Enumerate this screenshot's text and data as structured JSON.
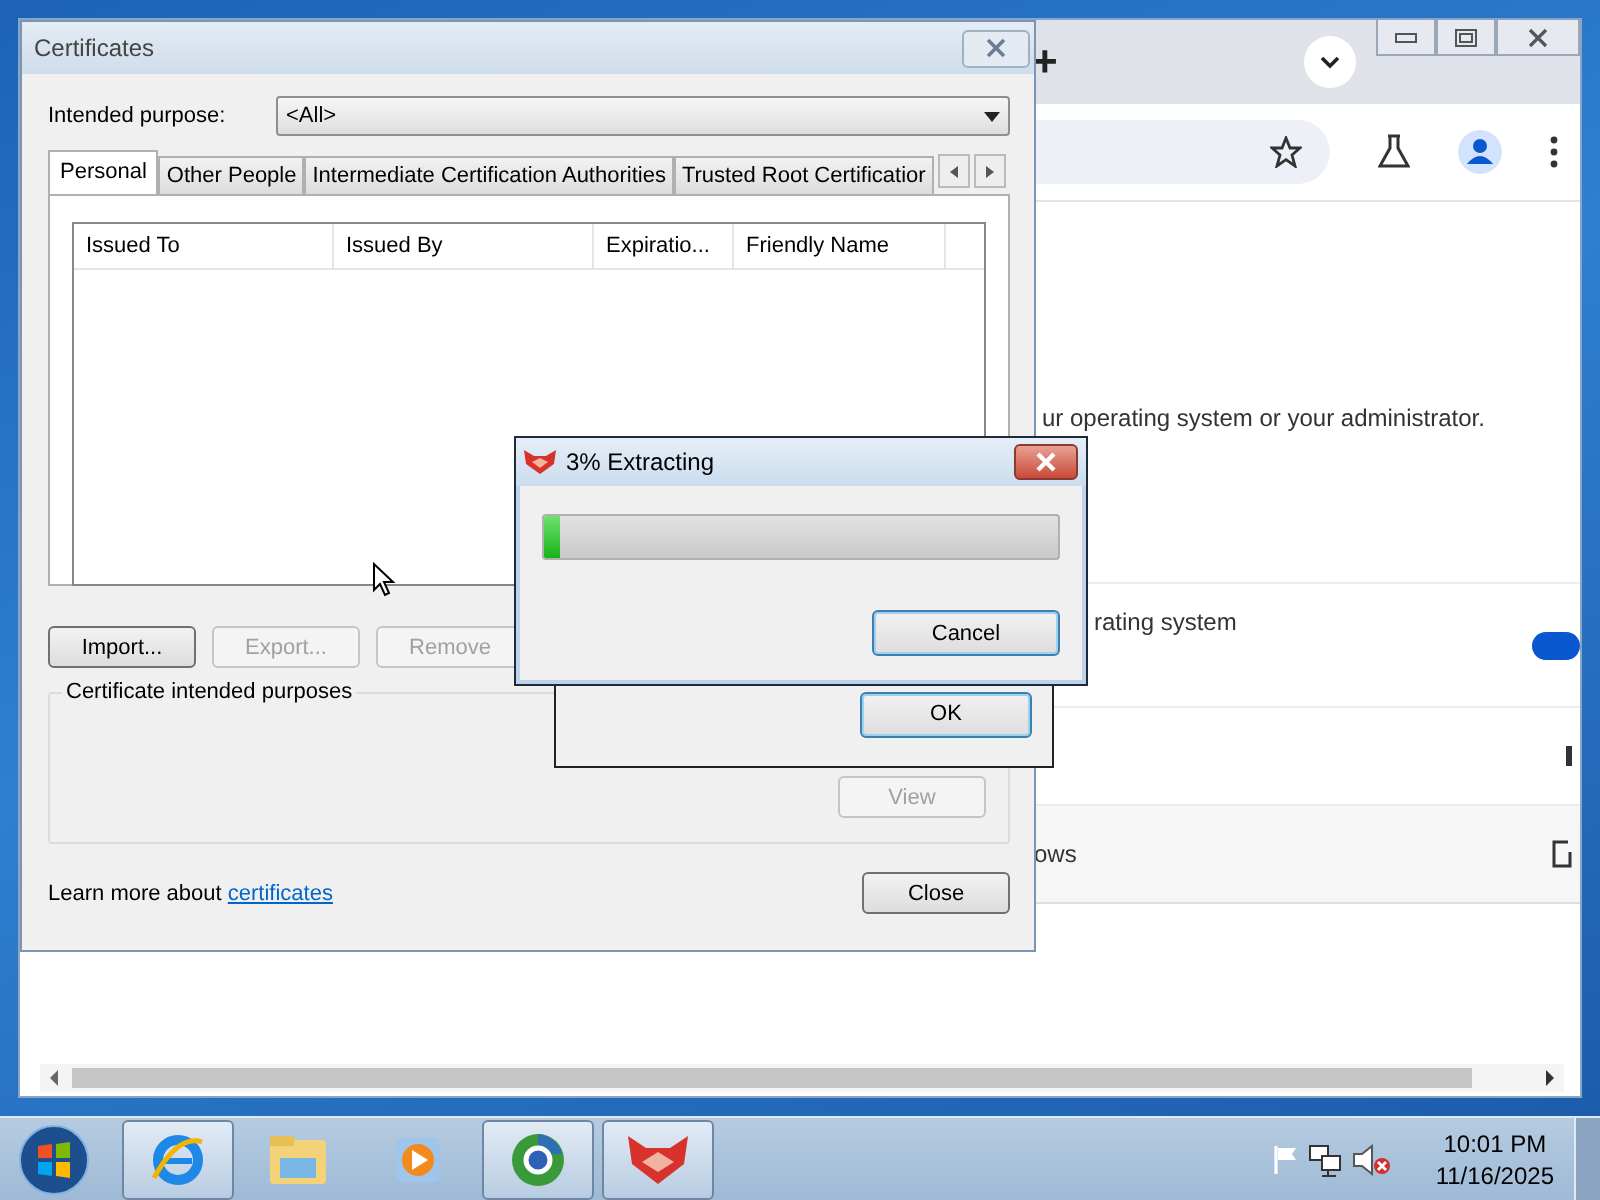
{
  "browser": {
    "new_tab": "+",
    "notice": "ur operating system or your administrator.",
    "setting": {
      "label": "rating system",
      "on": true
    },
    "row_text": "ows"
  },
  "certificates": {
    "title": "Certificates",
    "purpose_label": "Intended purpose:",
    "purpose_value": "<All>",
    "tabs": [
      {
        "label": "Personal",
        "selected": true
      },
      {
        "label": "Other People",
        "selected": false
      },
      {
        "label": "Intermediate Certification Authorities",
        "selected": false
      },
      {
        "label": "Trusted Root Certificatior",
        "selected": false
      }
    ],
    "columns": [
      "Issued To",
      "Issued By",
      "Expiratio...",
      "Friendly Name"
    ],
    "buttons": [
      {
        "label": "Import...",
        "disabled": false
      },
      {
        "label": "Export...",
        "disabled": true
      },
      {
        "label": "Remove",
        "disabled": true
      }
    ],
    "group_label": "Certificate intended purposes",
    "view_button": {
      "label": "View",
      "disabled": true
    },
    "learn_more": "Learn more about",
    "link": "certificates",
    "close": "Close"
  },
  "back_dialog": {
    "button": "OK"
  },
  "extract_dialog": {
    "title": "3% Extracting",
    "level": 0.03,
    "button": "Cancel"
  },
  "taskbar": {
    "apps": [
      {
        "kind": "ie",
        "running": true
      },
      {
        "kind": "explorer",
        "running": false
      },
      {
        "kind": "media",
        "running": false
      },
      {
        "kind": "chrome",
        "running": true
      },
      {
        "kind": "archiver",
        "running": true
      }
    ],
    "time": "10:01 PM",
    "date": "11/16/2025"
  }
}
